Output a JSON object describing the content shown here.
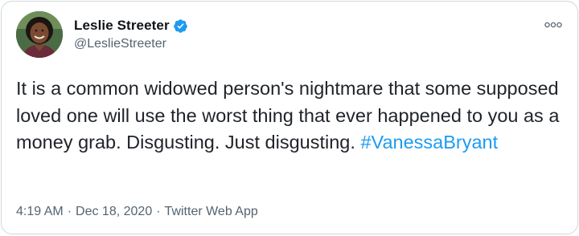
{
  "author": {
    "display_name": "Leslie Streeter",
    "handle": "@LeslieStreeter",
    "verified": true,
    "verified_icon": "verified-badge-icon"
  },
  "tweet": {
    "text_before_hashtag": "It is a common widowed person's nightmare that some supposed loved one will use the worst thing that ever happened to you as a money grab. Disgusting. Just disgusting. ",
    "hashtag": "#VanessaBryant"
  },
  "meta": {
    "time": "4:19 AM",
    "date": "Dec 18, 2020",
    "source": "Twitter Web App",
    "separator": "·"
  },
  "colors": {
    "link": "#1d9bf0",
    "secondary_text": "#536471",
    "border": "#cfd9de"
  },
  "menu_icon": "more-options-icon"
}
